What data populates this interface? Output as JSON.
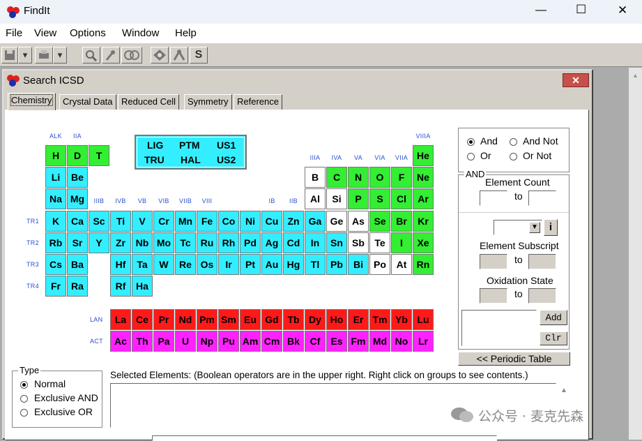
{
  "app": {
    "title": "FindIt"
  },
  "window_controls": {
    "minimize": "—",
    "maximize": "☐",
    "close": "✕"
  },
  "menu": [
    "File",
    "View",
    "Options",
    "Window",
    "Help"
  ],
  "toolbar": {
    "icons": [
      "save-icon",
      "print-icon",
      "search-icon",
      "query-icon",
      "link-icon",
      "view-icon",
      "tools-icon",
      "structure-icon"
    ],
    "s_label": "S"
  },
  "search_window": {
    "title": "Search ICSD",
    "close": "✕",
    "tabs": [
      "Chemistry",
      "Crystal Data",
      "Reduced Cell",
      "Symmetry",
      "Reference"
    ]
  },
  "colors": {
    "light": "#33eeff",
    "nonmetal": "#ffffff",
    "green": "#33ee33",
    "lanthanide": "#ff1a1a",
    "actinide": "#ff22ff",
    "group_label": "#2a4fd0"
  },
  "group_labels": [
    {
      "text": "ALK",
      "col": 0,
      "row": 0
    },
    {
      "text": "IIA",
      "col": 1,
      "row": 0
    },
    {
      "text": "VIIIA",
      "col": 17,
      "row": 0
    },
    {
      "text": "IIIA",
      "col": 12,
      "row": 1
    },
    {
      "text": "IVA",
      "col": 13,
      "row": 1
    },
    {
      "text": "VA",
      "col": 14,
      "row": 1
    },
    {
      "text": "VIA",
      "col": 15,
      "row": 1
    },
    {
      "text": "VIIA",
      "col": 16,
      "row": 1
    },
    {
      "text": "IIIB",
      "col": 2,
      "row": 2
    },
    {
      "text": "IVB",
      "col": 3,
      "row": 2
    },
    {
      "text": "VB",
      "col": 4,
      "row": 2
    },
    {
      "text": "VIB",
      "col": 5,
      "row": 2
    },
    {
      "text": "VIIB",
      "col": 6,
      "row": 2
    },
    {
      "text": "VIII",
      "col": 7,
      "row": 2
    },
    {
      "text": "IB",
      "col": 10,
      "row": 2
    },
    {
      "text": "IIB",
      "col": 11,
      "row": 2
    }
  ],
  "row_labels": [
    {
      "text": "TR1",
      "row": 3
    },
    {
      "text": "TR2",
      "row": 4
    },
    {
      "text": "TR3",
      "row": 5
    },
    {
      "text": "TR4",
      "row": 6
    },
    {
      "text": "LAN",
      "row": 7
    },
    {
      "text": "ACT",
      "row": 8
    }
  ],
  "group_box": {
    "items": [
      "LIG",
      "PTM",
      "US1",
      "TRU",
      "HAL",
      "US2"
    ]
  },
  "elements": [
    {
      "sym": "H",
      "row": 0,
      "col": 0,
      "c": "green"
    },
    {
      "sym": "D",
      "row": 0,
      "col": 1,
      "c": "green"
    },
    {
      "sym": "T",
      "row": 0,
      "col": 2,
      "c": "green"
    },
    {
      "sym": "He",
      "row": 0,
      "col": 17,
      "c": "green"
    },
    {
      "sym": "Li",
      "row": 1,
      "col": 0,
      "c": "light"
    },
    {
      "sym": "Be",
      "row": 1,
      "col": 1,
      "c": "light"
    },
    {
      "sym": "B",
      "row": 1,
      "col": 12,
      "c": "nonmetal"
    },
    {
      "sym": "C",
      "row": 1,
      "col": 13,
      "c": "green"
    },
    {
      "sym": "N",
      "row": 1,
      "col": 14,
      "c": "green"
    },
    {
      "sym": "O",
      "row": 1,
      "col": 15,
      "c": "green"
    },
    {
      "sym": "F",
      "row": 1,
      "col": 16,
      "c": "green"
    },
    {
      "sym": "Ne",
      "row": 1,
      "col": 17,
      "c": "green"
    },
    {
      "sym": "Na",
      "row": 2,
      "col": 0,
      "c": "light"
    },
    {
      "sym": "Mg",
      "row": 2,
      "col": 1,
      "c": "light"
    },
    {
      "sym": "Al",
      "row": 2,
      "col": 12,
      "c": "nonmetal"
    },
    {
      "sym": "Si",
      "row": 2,
      "col": 13,
      "c": "nonmetal"
    },
    {
      "sym": "P",
      "row": 2,
      "col": 14,
      "c": "green"
    },
    {
      "sym": "S",
      "row": 2,
      "col": 15,
      "c": "green"
    },
    {
      "sym": "Cl",
      "row": 2,
      "col": 16,
      "c": "green"
    },
    {
      "sym": "Ar",
      "row": 2,
      "col": 17,
      "c": "green"
    },
    {
      "sym": "K",
      "row": 3,
      "col": 0,
      "c": "light"
    },
    {
      "sym": "Ca",
      "row": 3,
      "col": 1,
      "c": "light"
    },
    {
      "sym": "Sc",
      "row": 3,
      "col": 2,
      "c": "light"
    },
    {
      "sym": "Ti",
      "row": 3,
      "col": 3,
      "c": "light"
    },
    {
      "sym": "V",
      "row": 3,
      "col": 4,
      "c": "light"
    },
    {
      "sym": "Cr",
      "row": 3,
      "col": 5,
      "c": "light"
    },
    {
      "sym": "Mn",
      "row": 3,
      "col": 6,
      "c": "light"
    },
    {
      "sym": "Fe",
      "row": 3,
      "col": 7,
      "c": "light"
    },
    {
      "sym": "Co",
      "row": 3,
      "col": 8,
      "c": "light"
    },
    {
      "sym": "Ni",
      "row": 3,
      "col": 9,
      "c": "light"
    },
    {
      "sym": "Cu",
      "row": 3,
      "col": 10,
      "c": "light"
    },
    {
      "sym": "Zn",
      "row": 3,
      "col": 11,
      "c": "light"
    },
    {
      "sym": "Ga",
      "row": 3,
      "col": 12,
      "c": "light"
    },
    {
      "sym": "Ge",
      "row": 3,
      "col": 13,
      "c": "nonmetal"
    },
    {
      "sym": "As",
      "row": 3,
      "col": 14,
      "c": "nonmetal"
    },
    {
      "sym": "Se",
      "row": 3,
      "col": 15,
      "c": "green"
    },
    {
      "sym": "Br",
      "row": 3,
      "col": 16,
      "c": "green"
    },
    {
      "sym": "Kr",
      "row": 3,
      "col": 17,
      "c": "green"
    },
    {
      "sym": "Rb",
      "row": 4,
      "col": 0,
      "c": "light"
    },
    {
      "sym": "Sr",
      "row": 4,
      "col": 1,
      "c": "light"
    },
    {
      "sym": "Y",
      "row": 4,
      "col": 2,
      "c": "light"
    },
    {
      "sym": "Zr",
      "row": 4,
      "col": 3,
      "c": "light"
    },
    {
      "sym": "Nb",
      "row": 4,
      "col": 4,
      "c": "light"
    },
    {
      "sym": "Mo",
      "row": 4,
      "col": 5,
      "c": "light"
    },
    {
      "sym": "Tc",
      "row": 4,
      "col": 6,
      "c": "light"
    },
    {
      "sym": "Ru",
      "row": 4,
      "col": 7,
      "c": "light"
    },
    {
      "sym": "Rh",
      "row": 4,
      "col": 8,
      "c": "light"
    },
    {
      "sym": "Pd",
      "row": 4,
      "col": 9,
      "c": "light"
    },
    {
      "sym": "Ag",
      "row": 4,
      "col": 10,
      "c": "light"
    },
    {
      "sym": "Cd",
      "row": 4,
      "col": 11,
      "c": "light"
    },
    {
      "sym": "In",
      "row": 4,
      "col": 12,
      "c": "light"
    },
    {
      "sym": "Sn",
      "row": 4,
      "col": 13,
      "c": "light"
    },
    {
      "sym": "Sb",
      "row": 4,
      "col": 14,
      "c": "nonmetal"
    },
    {
      "sym": "Te",
      "row": 4,
      "col": 15,
      "c": "nonmetal"
    },
    {
      "sym": "I",
      "row": 4,
      "col": 16,
      "c": "green"
    },
    {
      "sym": "Xe",
      "row": 4,
      "col": 17,
      "c": "green"
    },
    {
      "sym": "Cs",
      "row": 5,
      "col": 0,
      "c": "light"
    },
    {
      "sym": "Ba",
      "row": 5,
      "col": 1,
      "c": "light"
    },
    {
      "sym": "Hf",
      "row": 5,
      "col": 3,
      "c": "light"
    },
    {
      "sym": "Ta",
      "row": 5,
      "col": 4,
      "c": "light"
    },
    {
      "sym": "W",
      "row": 5,
      "col": 5,
      "c": "light"
    },
    {
      "sym": "Re",
      "row": 5,
      "col": 6,
      "c": "light"
    },
    {
      "sym": "Os",
      "row": 5,
      "col": 7,
      "c": "light"
    },
    {
      "sym": "Ir",
      "row": 5,
      "col": 8,
      "c": "light"
    },
    {
      "sym": "Pt",
      "row": 5,
      "col": 9,
      "c": "light"
    },
    {
      "sym": "Au",
      "row": 5,
      "col": 10,
      "c": "light"
    },
    {
      "sym": "Hg",
      "row": 5,
      "col": 11,
      "c": "light"
    },
    {
      "sym": "Tl",
      "row": 5,
      "col": 12,
      "c": "light"
    },
    {
      "sym": "Pb",
      "row": 5,
      "col": 13,
      "c": "light"
    },
    {
      "sym": "Bi",
      "row": 5,
      "col": 14,
      "c": "light"
    },
    {
      "sym": "Po",
      "row": 5,
      "col": 15,
      "c": "nonmetal"
    },
    {
      "sym": "At",
      "row": 5,
      "col": 16,
      "c": "nonmetal"
    },
    {
      "sym": "Rn",
      "row": 5,
      "col": 17,
      "c": "green"
    },
    {
      "sym": "Fr",
      "row": 6,
      "col": 0,
      "c": "light"
    },
    {
      "sym": "Ra",
      "row": 6,
      "col": 1,
      "c": "light"
    },
    {
      "sym": "Rf",
      "row": 6,
      "col": 3,
      "c": "light"
    },
    {
      "sym": "Ha",
      "row": 6,
      "col": 4,
      "c": "light"
    },
    {
      "sym": "La",
      "row": 7,
      "col": 3,
      "c": "lanthanide"
    },
    {
      "sym": "Ce",
      "row": 7,
      "col": 4,
      "c": "lanthanide"
    },
    {
      "sym": "Pr",
      "row": 7,
      "col": 5,
      "c": "lanthanide"
    },
    {
      "sym": "Nd",
      "row": 7,
      "col": 6,
      "c": "lanthanide"
    },
    {
      "sym": "Pm",
      "row": 7,
      "col": 7,
      "c": "lanthanide"
    },
    {
      "sym": "Sm",
      "row": 7,
      "col": 8,
      "c": "lanthanide"
    },
    {
      "sym": "Eu",
      "row": 7,
      "col": 9,
      "c": "lanthanide"
    },
    {
      "sym": "Gd",
      "row": 7,
      "col": 10,
      "c": "lanthanide"
    },
    {
      "sym": "Tb",
      "row": 7,
      "col": 11,
      "c": "lanthanide"
    },
    {
      "sym": "Dy",
      "row": 7,
      "col": 12,
      "c": "lanthanide"
    },
    {
      "sym": "Ho",
      "row": 7,
      "col": 13,
      "c": "lanthanide"
    },
    {
      "sym": "Er",
      "row": 7,
      "col": 14,
      "c": "lanthanide"
    },
    {
      "sym": "Tm",
      "row": 7,
      "col": 15,
      "c": "lanthanide"
    },
    {
      "sym": "Yb",
      "row": 7,
      "col": 16,
      "c": "lanthanide"
    },
    {
      "sym": "Lu",
      "row": 7,
      "col": 17,
      "c": "lanthanide"
    },
    {
      "sym": "Ac",
      "row": 8,
      "col": 3,
      "c": "actinide"
    },
    {
      "sym": "Th",
      "row": 8,
      "col": 4,
      "c": "actinide"
    },
    {
      "sym": "Pa",
      "row": 8,
      "col": 5,
      "c": "actinide"
    },
    {
      "sym": "U",
      "row": 8,
      "col": 6,
      "c": "actinide"
    },
    {
      "sym": "Np",
      "row": 8,
      "col": 7,
      "c": "actinide"
    },
    {
      "sym": "Pu",
      "row": 8,
      "col": 8,
      "c": "actinide"
    },
    {
      "sym": "Am",
      "row": 8,
      "col": 9,
      "c": "actinide"
    },
    {
      "sym": "Cm",
      "row": 8,
      "col": 10,
      "c": "actinide"
    },
    {
      "sym": "Bk",
      "row": 8,
      "col": 11,
      "c": "actinide"
    },
    {
      "sym": "Cf",
      "row": 8,
      "col": 12,
      "c": "actinide"
    },
    {
      "sym": "Es",
      "row": 8,
      "col": 13,
      "c": "actinide"
    },
    {
      "sym": "Fm",
      "row": 8,
      "col": 14,
      "c": "actinide"
    },
    {
      "sym": "Md",
      "row": 8,
      "col": 15,
      "c": "actinide"
    },
    {
      "sym": "No",
      "row": 8,
      "col": 16,
      "c": "actinide"
    },
    {
      "sym": "Lr",
      "row": 8,
      "col": 17,
      "c": "actinide"
    }
  ],
  "boolean_ops": {
    "options": [
      "And",
      "And Not",
      "Or",
      "Or Not"
    ],
    "selected": "And"
  },
  "and_box": {
    "title": "AND",
    "element_count_label": "Element Count",
    "to1": "to",
    "element_subscript_label": "Element Subscript",
    "to2": "to",
    "oxidation_state_label": "Oxidation State",
    "to3": "to",
    "info_button": "i",
    "add_button": "Add",
    "clr_button": "Clr"
  },
  "periodic_table_button": "<< Periodic Table",
  "type_box": {
    "title": "Type",
    "options": [
      "Normal",
      "Exclusive AND",
      "Exclusive OR"
    ],
    "selected": "Normal"
  },
  "selected_elements_label": "Selected Elements: (Boolean operators are in the upper right.  Right click on groups to see contents.)",
  "watermark": "公众号 · 麦克先森"
}
